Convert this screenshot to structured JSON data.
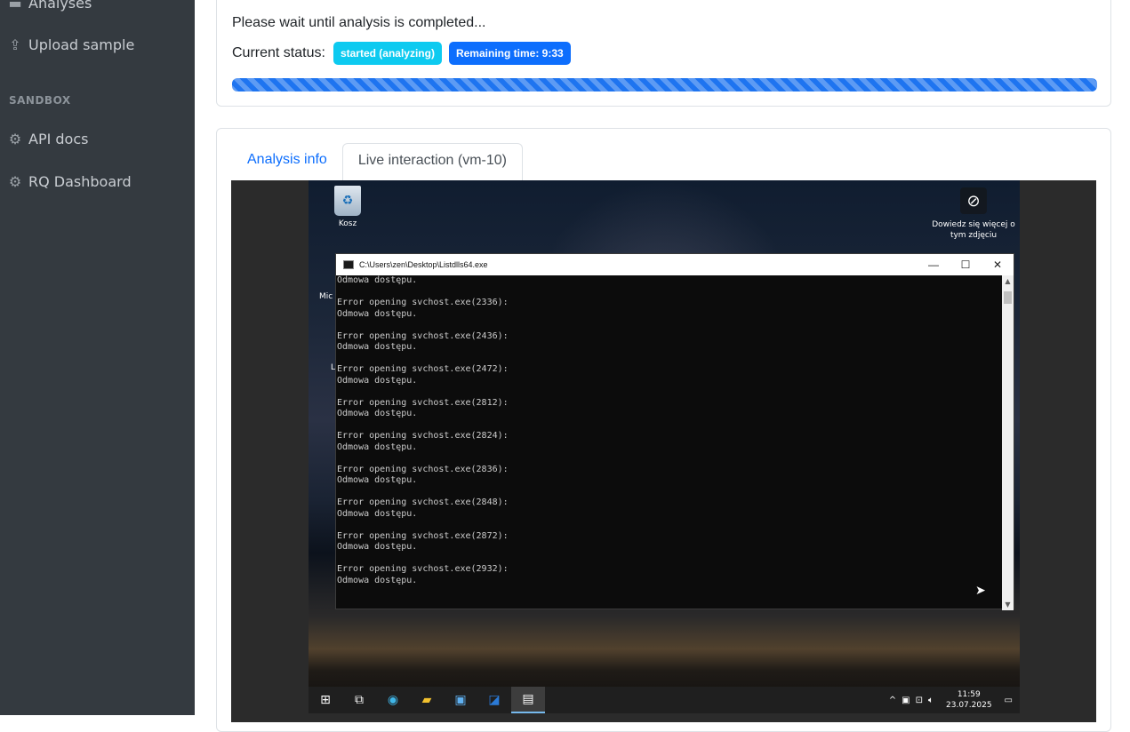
{
  "sidebar": {
    "items_top": [
      {
        "label": "Analyses",
        "icon": "list-icon"
      },
      {
        "label": "Upload sample",
        "icon": "upload-icon"
      }
    ],
    "section": "SANDBOX",
    "items_bottom": [
      {
        "label": "API docs",
        "icon": "gear-icon"
      },
      {
        "label": "RQ Dashboard",
        "icon": "gear-icon"
      }
    ]
  },
  "status_card": {
    "wait_text": "Please wait until analysis is completed...",
    "status_label": "Current status:",
    "status_badge": "started (analyzing)",
    "remaining_badge": "Remaining time: 9:33",
    "progress_pct": 100
  },
  "tabs": [
    {
      "label": "Analysis info",
      "active": false
    },
    {
      "label": "Live interaction (vm-10)",
      "active": true
    }
  ],
  "vm": {
    "desktop_icons": {
      "recycle_bin": "Kosz",
      "learn_more": "Dowiedz się więcej o tym zdjęciu",
      "partial_1": "Mic",
      "partial_2": "L"
    },
    "cmd_window": {
      "title": "C:\\Users\\zen\\Desktop\\Listdlls64.exe",
      "lines": [
        "Odmowa dostępu.",
        "",
        "Error opening svchost.exe(2336):",
        "Odmowa dostępu.",
        "",
        "Error opening svchost.exe(2436):",
        "Odmowa dostępu.",
        "",
        "Error opening svchost.exe(2472):",
        "Odmowa dostępu.",
        "",
        "Error opening svchost.exe(2812):",
        "Odmowa dostępu.",
        "",
        "Error opening svchost.exe(2824):",
        "Odmowa dostępu.",
        "",
        "Error opening svchost.exe(2836):",
        "Odmowa dostępu.",
        "",
        "Error opening svchost.exe(2848):",
        "Odmowa dostępu.",
        "",
        "Error opening svchost.exe(2872):",
        "Odmowa dostępu.",
        "",
        "Error opening svchost.exe(2932):",
        "Odmowa dostępu."
      ]
    },
    "taskbar": {
      "time": "11:59",
      "date": "23.07.2025",
      "apps": [
        "windows-start-icon",
        "task-view-icon",
        "edge-icon",
        "file-explorer-icon",
        "store-icon",
        "outlook-icon",
        "cmd-icon"
      ]
    }
  }
}
